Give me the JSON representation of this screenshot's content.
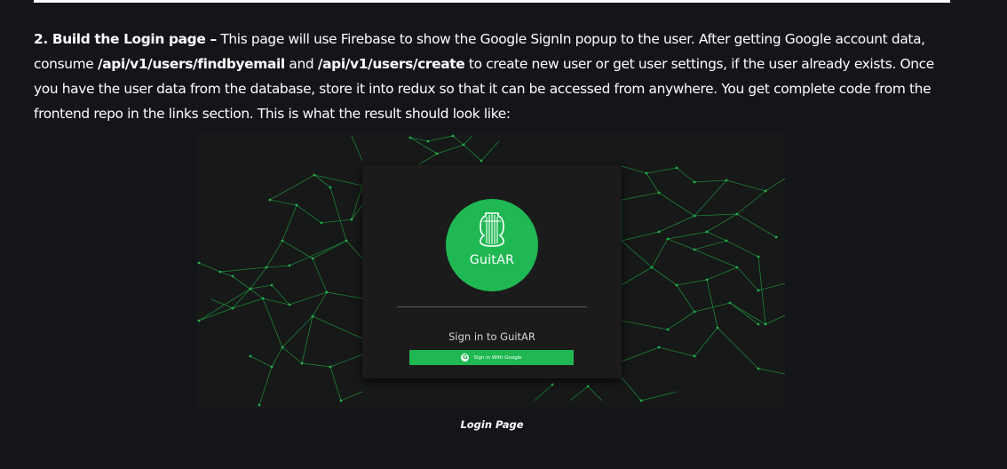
{
  "article": {
    "step_heading": "2. Build the Login page –",
    "text_1": " This page will use Firebase to show the Google SignIn popup to the user. After getting Google account data, consume ",
    "api_findbyemail": "/api/v1/users/findbyemail",
    "text_2": " and ",
    "api_create": "/api/v1/users/create",
    "text_3": " to create new user or get user settings, if the user already exists. Once you have the user data from the database, store it into redux so that it can be accessed from anywhere. You get complete code from the frontend repo in the links section. This is what the result should look like:"
  },
  "figure": {
    "logo_icon": "guitar-icon",
    "app_name": "GuitAR",
    "signin_heading": "Sign in to GuitAR",
    "google_button_icon": "google-icon",
    "google_button_icon_glyph": "G",
    "google_button_label": "Sign in With Google",
    "caption": "Login Page",
    "colors": {
      "brand_green": "#1fb853",
      "network_line": "#1d8f3c",
      "background": "#171818",
      "card": "#1b1b1b"
    }
  }
}
